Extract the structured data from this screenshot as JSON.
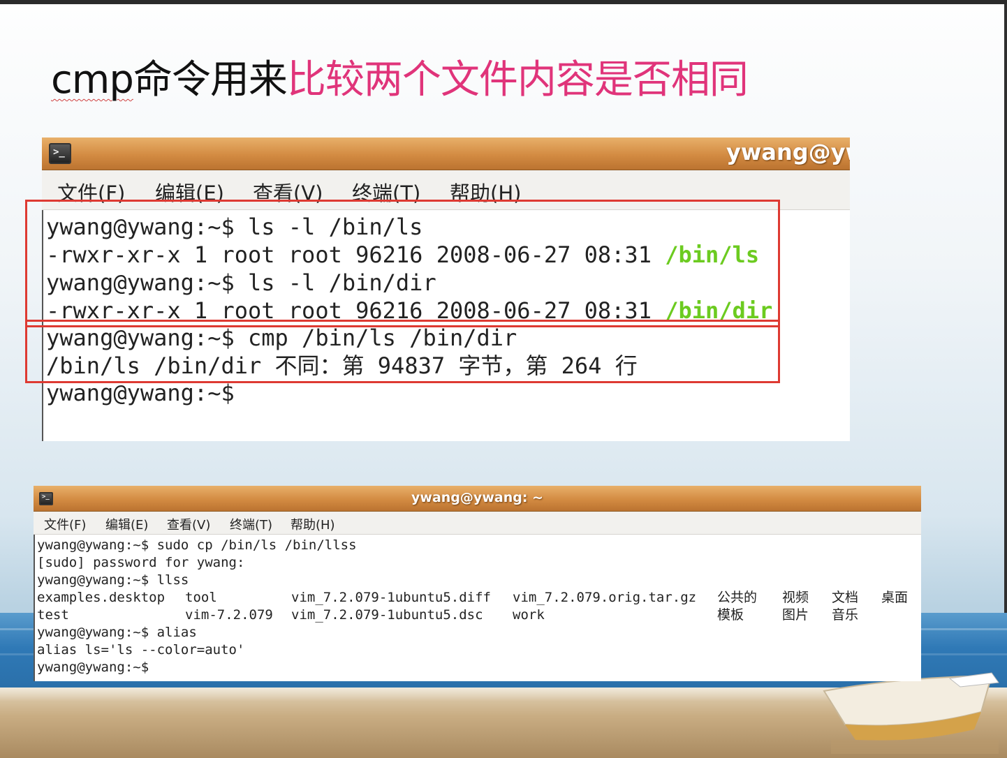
{
  "slide": {
    "title_cmd": "cmp",
    "title_rest": "命令用来",
    "title_highlight": "比较两个文件内容是否相同"
  },
  "terminal1": {
    "title": "ywang@yw",
    "menu": [
      "文件(F)",
      "编辑(E)",
      "查看(V)",
      "终端(T)",
      "帮助(H)"
    ],
    "lines": [
      {
        "text": "ywang@ywang:~$ ls -l /bin/ls",
        "hl": ""
      },
      {
        "text": "-rwxr-xr-x 1 root root 96216 2008-06-27 08:31 ",
        "hl": "/bin/ls"
      },
      {
        "text": "ywang@ywang:~$ ls -l /bin/dir",
        "hl": ""
      },
      {
        "text": "-rwxr-xr-x 1 root root 96216 2008-06-27 08:31 ",
        "hl": "/bin/dir"
      },
      {
        "text": "ywang@ywang:~$ cmp /bin/ls /bin/dir",
        "hl": ""
      },
      {
        "text": "/bin/ls /bin/dir 不同：第 94837 字节，第 264 行",
        "hl": ""
      },
      {
        "text": "ywang@ywang:~$",
        "hl": ""
      }
    ]
  },
  "terminal2": {
    "title": "ywang@ywang: ~",
    "menu": [
      "文件(F)",
      "编辑(E)",
      "查看(V)",
      "终端(T)",
      "帮助(H)"
    ],
    "lines": [
      "ywang@ywang:~$ sudo cp /bin/ls /bin/llss",
      "[sudo] password for ywang:",
      "ywang@ywang:~$ llss",
      "",
      "",
      "ywang@ywang:~$ alias",
      "alias ls='ls --color=auto'",
      "ywang@ywang:~$"
    ],
    "listing": {
      "row1": [
        "examples.desktop",
        "tool",
        "vim_7.2.079-1ubuntu5.diff",
        "vim_7.2.079.orig.tar.gz",
        "公共的",
        "视频",
        "文档",
        "桌面"
      ],
      "row2": [
        "test",
        "vim-7.2.079",
        "vim_7.2.079-1ubuntu5.dsc",
        "work",
        "模板",
        "图片",
        "音乐",
        ""
      ]
    }
  },
  "colors": {
    "accent_pink": "#e0347a",
    "highlight_box": "#de3a32",
    "ls_green": "#6ccb20",
    "titlebar_orange": "#d38b42"
  }
}
